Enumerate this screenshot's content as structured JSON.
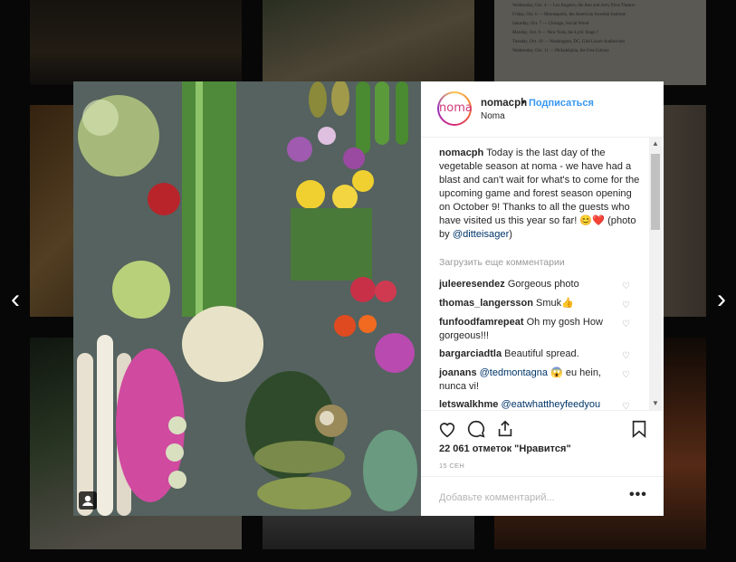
{
  "nav": {
    "prev_arrow": "‹",
    "next_arrow": "›"
  },
  "post": {
    "username": "nomacph",
    "avatar_text": "noma",
    "follow_label": "Подписаться",
    "location": "Noma",
    "caption_user": "nomacph",
    "caption_text": "Today is the last day of the vegetable season at noma - we have had a blast and can't wait for what's to come for the upcoming game and forest season opening on October 9! Thanks to all the guests who have visited us this year so far! 😊❤️ (photo by",
    "caption_mention": "@ditteisager",
    "caption_end": ")",
    "load_more": "Загрузить еще комментарии",
    "comments": [
      {
        "user": "juleeresendez",
        "text": "Gorgeous photo"
      },
      {
        "user": "thomas_langersson",
        "text": "Smuk👍"
      },
      {
        "user": "funfoodfamrepeat",
        "text": "Oh my gosh How gorgeous!!!"
      },
      {
        "user": "bargarciadtla",
        "text": "Beautiful spread."
      },
      {
        "user": "joanans",
        "mention": "@tedmontagna",
        "text": "😱 eu hein, nunca vi!"
      },
      {
        "user": "letswalkhme",
        "mention": "@eatwhattheyfeedyou",
        "text": ""
      }
    ],
    "likes": "22 061 отметок \"Нравится\"",
    "date": "15 СЕН",
    "add_comment_placeholder": "Добавьте комментарий...",
    "more_label": "•••"
  },
  "bg_event_list": [
    "Wednesday, Oct. 4 — Los Angeles, the Ann and Jerry Price Theatre",
    "Friday, Oct. 6 — Minneapolis, the American Swedish Institute",
    "Saturday, Oct. 7 — Chicago, Social Wood",
    "Monday, Oct. 9 — New York, the Lyric Stage ?",
    "Tuesday, Oct. 10 — Washington, DC, Gild Lisner Auditorium",
    "Wednesday, Oct. 11 — Philadelphia, the Free Library"
  ],
  "colors": {
    "accent": "#3897f0",
    "text": "#262626",
    "muted": "#999999",
    "border": "#efefef",
    "mention": "#003569"
  }
}
